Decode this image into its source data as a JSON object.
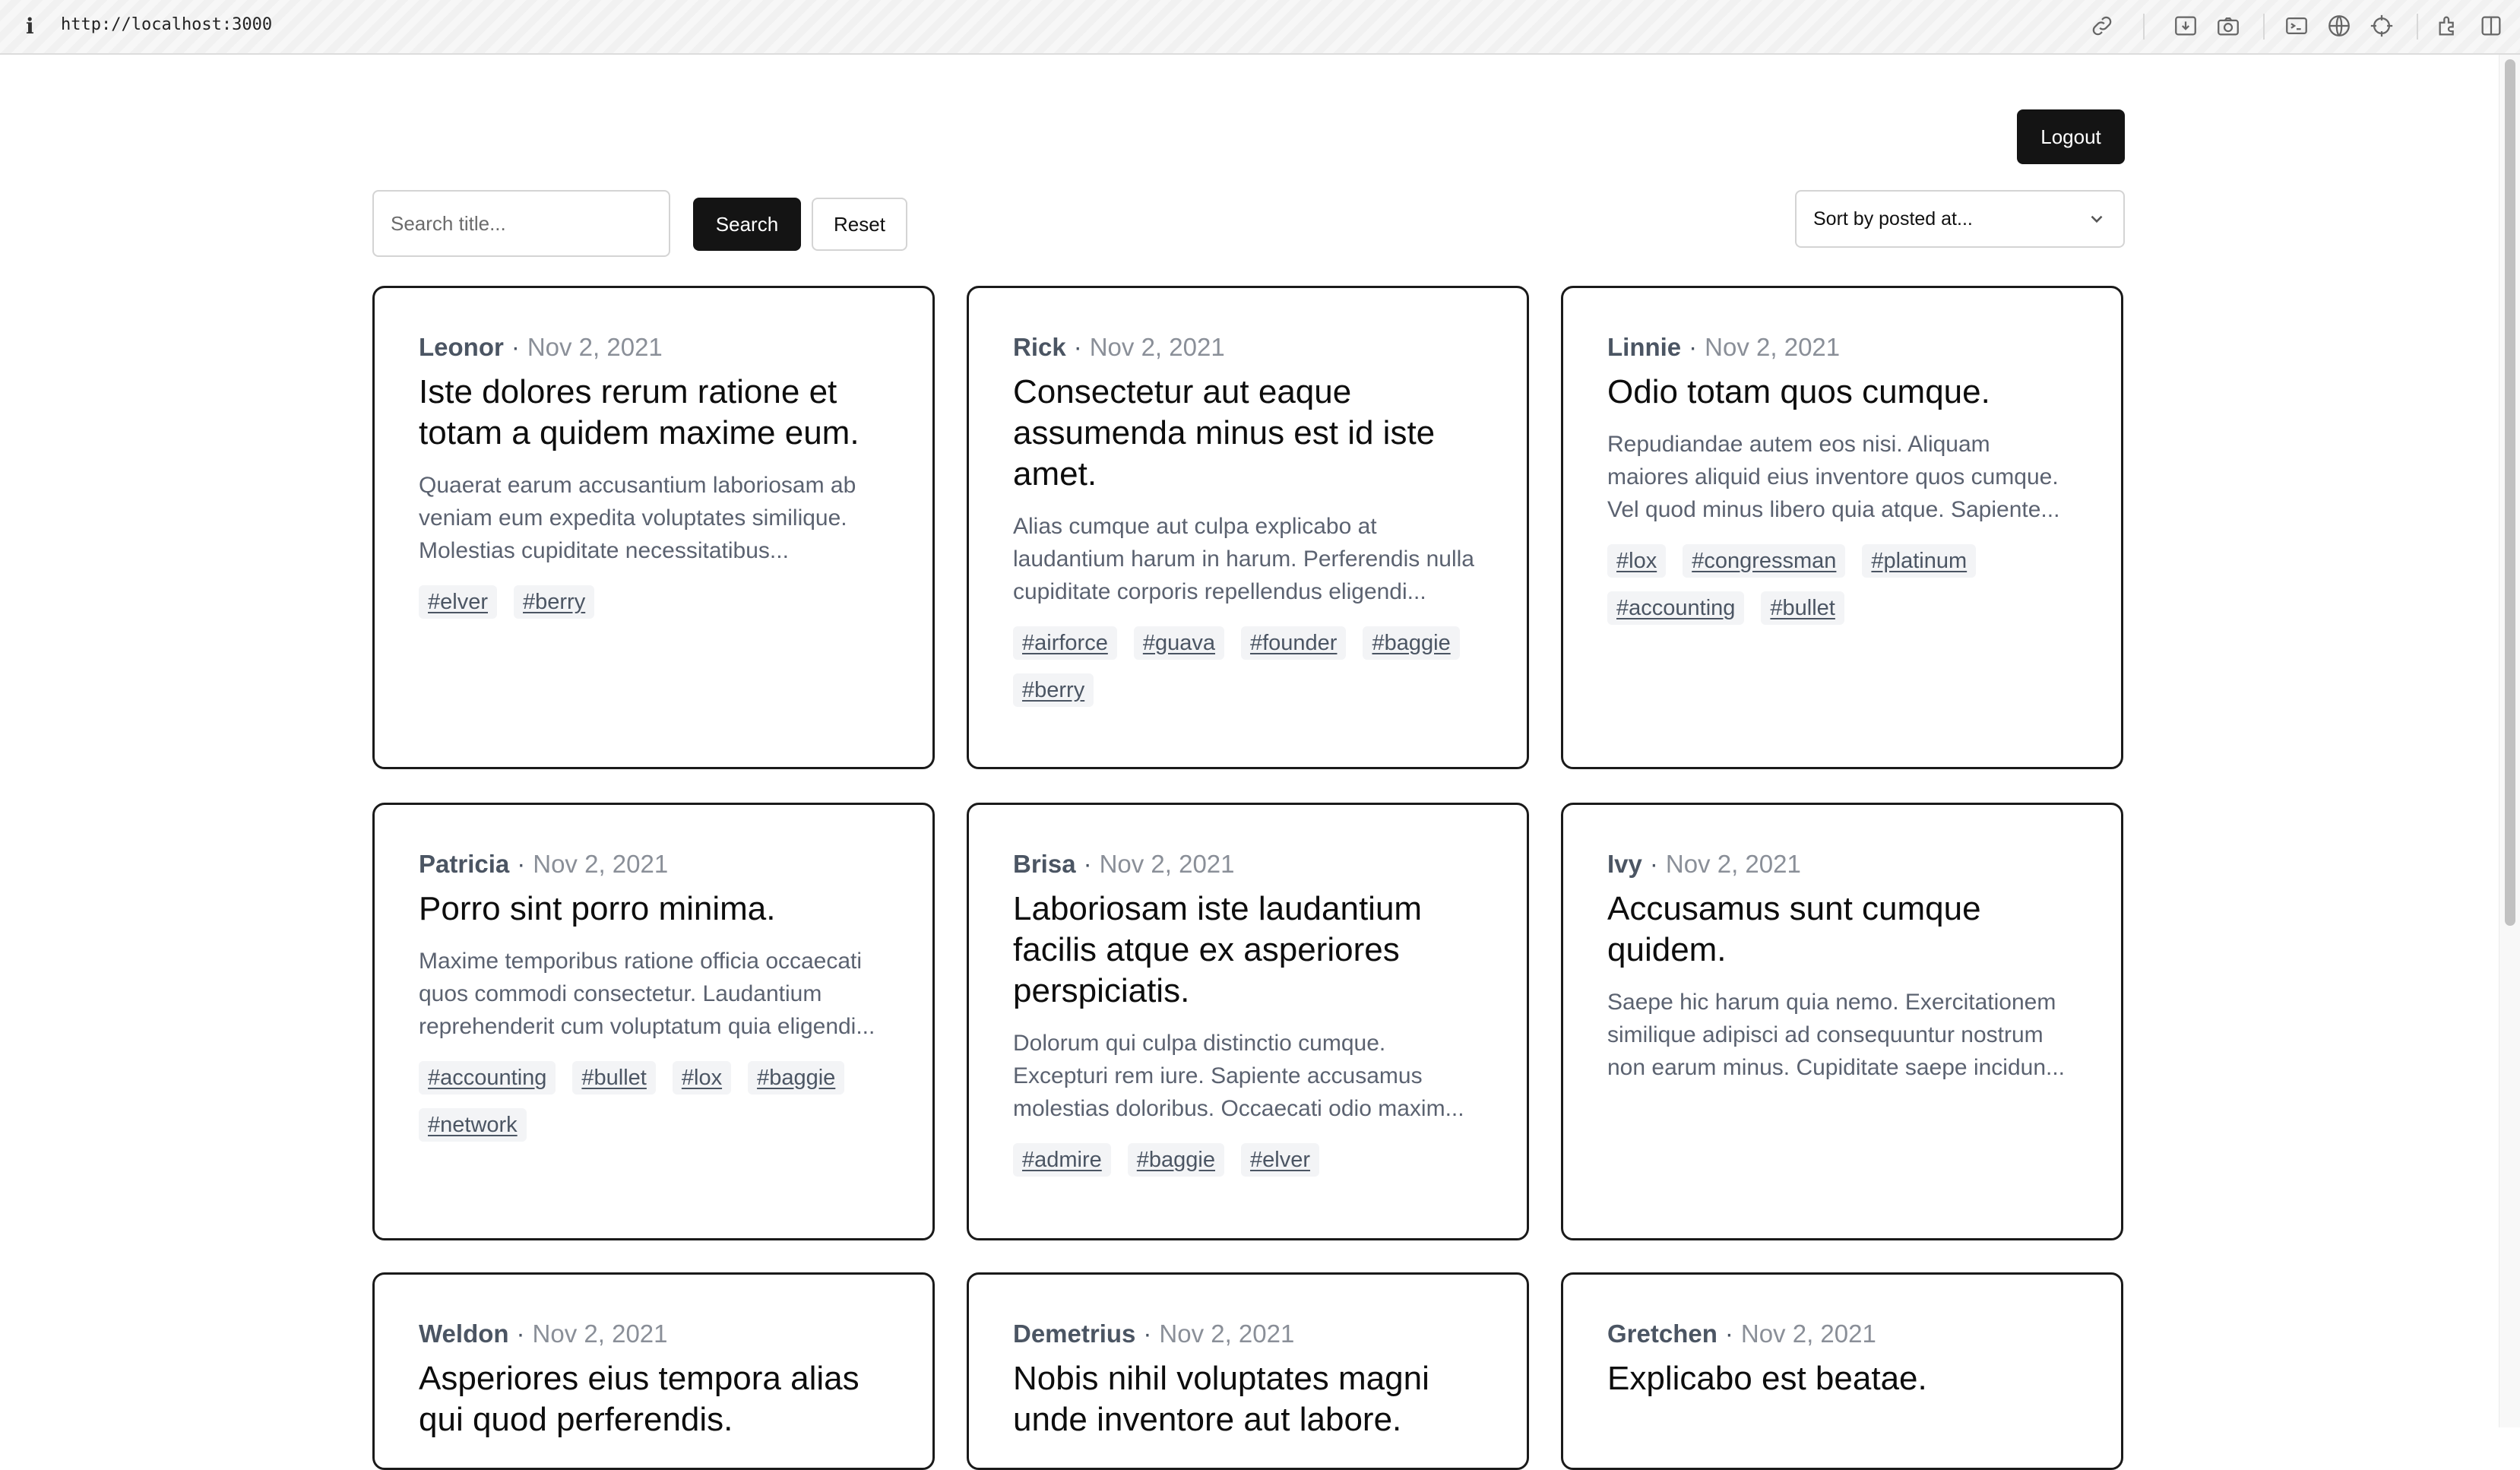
{
  "browser": {
    "url": "http://localhost:3000",
    "info_glyph": "i",
    "toolbar_icons": [
      "link-icon",
      "download-icon",
      "camera-icon",
      "terminal-icon",
      "globe-icon",
      "crosshair-icon",
      "extensions-icon",
      "sidebar-icon"
    ]
  },
  "header": {
    "logout_label": "Logout"
  },
  "search": {
    "placeholder": "Search title...",
    "value": "",
    "search_label": "Search",
    "reset_label": "Reset"
  },
  "sort": {
    "label": "Sort by posted at..."
  },
  "posts": [
    {
      "author": "Leonor",
      "date": "Nov 2, 2021",
      "title": "Iste dolores rerum ratione et totam a quidem maxime eum.",
      "excerpt": "Quaerat earum accusantium laboriosam ab veniam eum expedita voluptates similique. Molestias cupiditate necessitatibus...",
      "tags": [
        "#elver",
        "#berry"
      ]
    },
    {
      "author": "Rick",
      "date": "Nov 2, 2021",
      "title": "Consectetur aut eaque assumenda minus est id iste amet.",
      "excerpt": "Alias cumque aut culpa explicabo at laudantium harum in harum. Perferendis nulla cupiditate corporis repellendus eligendi...",
      "tags": [
        "#airforce",
        "#guava",
        "#founder",
        "#baggie",
        "#berry"
      ]
    },
    {
      "author": "Linnie",
      "date": "Nov 2, 2021",
      "title": "Odio totam quos cumque.",
      "excerpt": "Repudiandae autem eos nisi. Aliquam maiores aliquid eius inventore quos cumque. Vel quod minus libero quia atque. Sapiente...",
      "tags": [
        "#lox",
        "#congressman",
        "#platinum",
        "#accounting",
        "#bullet"
      ]
    },
    {
      "author": "Patricia",
      "date": "Nov 2, 2021",
      "title": "Porro sint porro minima.",
      "excerpt": "Maxime temporibus ratione officia occaecati quos commodi consectetur. Laudantium reprehenderit cum voluptatum quia eligendi...",
      "tags": [
        "#accounting",
        "#bullet",
        "#lox",
        "#baggie",
        "#network"
      ]
    },
    {
      "author": "Brisa",
      "date": "Nov 2, 2021",
      "title": "Laboriosam iste laudantium facilis atque ex asperiores perspiciatis.",
      "excerpt": "Dolorum qui culpa distinctio cumque. Excepturi rem iure. Sapiente accusamus molestias doloribus. Occaecati odio maxim...",
      "tags": [
        "#admire",
        "#baggie",
        "#elver"
      ]
    },
    {
      "author": "Ivy",
      "date": "Nov 2, 2021",
      "title": "Accusamus sunt cumque quidem.",
      "excerpt": "Saepe hic harum quia nemo. Exercitationem similique adipisci ad consequuntur nostrum non earum minus. Cupiditate saepe incidun...",
      "tags": []
    },
    {
      "author": "Weldon",
      "date": "Nov 2, 2021",
      "title": "Asperiores eius tempora alias qui quod perferendis.",
      "excerpt": "",
      "tags": []
    },
    {
      "author": "Demetrius",
      "date": "Nov 2, 2021",
      "title": "Nobis nihil voluptates magni unde inventore aut labore.",
      "excerpt": "",
      "tags": []
    },
    {
      "author": "Gretchen",
      "date": "Nov 2, 2021",
      "title": "Explicabo est beatae.",
      "excerpt": "",
      "tags": []
    }
  ]
}
